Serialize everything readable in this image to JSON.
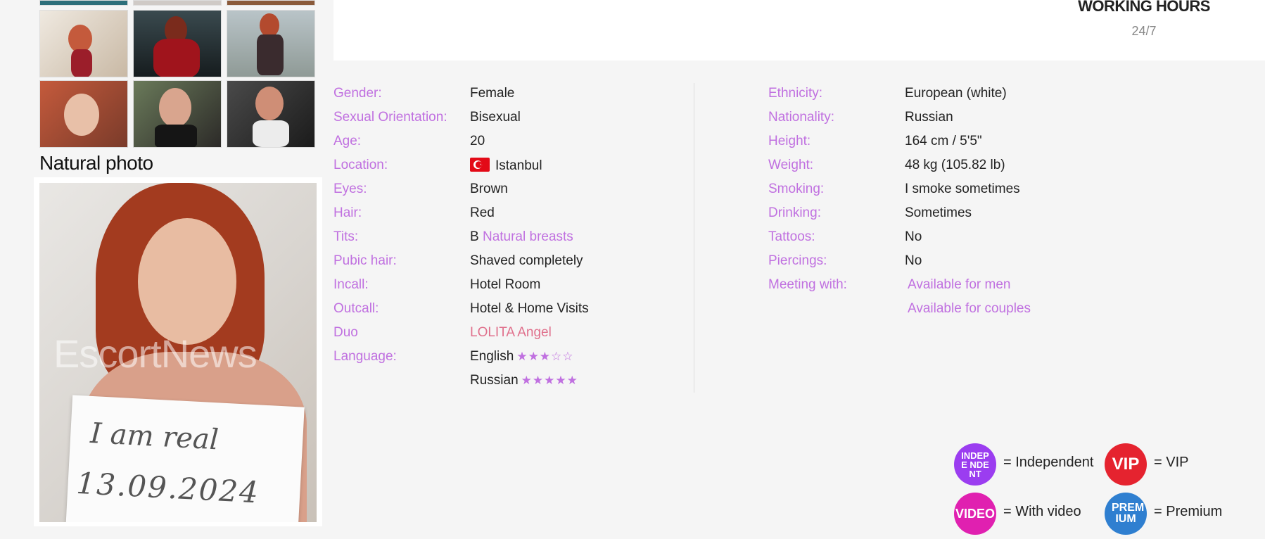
{
  "gallery": {
    "natural_title": "Natural photo",
    "watermark": "EscortNews",
    "sign_line1": "I am real",
    "sign_line2": "13.09.2024"
  },
  "working_hours": {
    "title": "WORKING HOURS",
    "value": "24/7"
  },
  "details_left": [
    {
      "label": "Gender:",
      "value": "Female"
    },
    {
      "label": "Sexual Orientation:",
      "value": "Bisexual"
    },
    {
      "label": "Age:",
      "value": "20"
    },
    {
      "label": "Location:",
      "value": "Istanbul"
    },
    {
      "label": "Eyes:",
      "value": "Brown"
    },
    {
      "label": "Hair:",
      "value": "Red"
    },
    {
      "label": "Tits:",
      "value": "B",
      "link": "Natural breasts"
    },
    {
      "label": "Pubic hair:",
      "value": "Shaved completely"
    },
    {
      "label": "Incall:",
      "value": "Hotel Room"
    },
    {
      "label": "Outcall:",
      "value": "Hotel & Home Visits"
    },
    {
      "label": "Duo",
      "value": "LOLITA Angel"
    },
    {
      "label": "Language:",
      "value": "English",
      "stars": "★★★☆☆"
    },
    {
      "label": "",
      "value": "Russian",
      "stars": "★★★★★"
    }
  ],
  "details_right": [
    {
      "label": "Ethnicity:",
      "value": "European (white)"
    },
    {
      "label": "Nationality:",
      "value": "Russian"
    },
    {
      "label": "Height:",
      "value": "164 cm / 5'5\""
    },
    {
      "label": "Weight:",
      "value": "48 kg (105.82 lb)"
    },
    {
      "label": "Smoking:",
      "value": "I smoke sometimes"
    },
    {
      "label": "Drinking:",
      "value": "Sometimes"
    },
    {
      "label": "Tattoos:",
      "value": "No"
    },
    {
      "label": "Piercings:",
      "value": "No"
    },
    {
      "label": "Meeting with:",
      "value": "Available for men"
    },
    {
      "label": "",
      "value": "Available for couples"
    }
  ],
  "legend": {
    "independent": {
      "badge": "INDEPE NDENT",
      "text": "= Independent",
      "color": "#9b3df0"
    },
    "vip": {
      "badge": "VIP",
      "text": "= VIP",
      "color": "#e5232f"
    },
    "video": {
      "badge": "VIDEO",
      "text": "= With video",
      "color": "#e020b0"
    },
    "premium": {
      "badge": "PREM IUM",
      "text": "= Premium",
      "color": "#2f7fd0"
    }
  },
  "colors": {
    "label": "#c070e0",
    "duo_link": "#e0708c",
    "background": "#f5f5f5"
  }
}
